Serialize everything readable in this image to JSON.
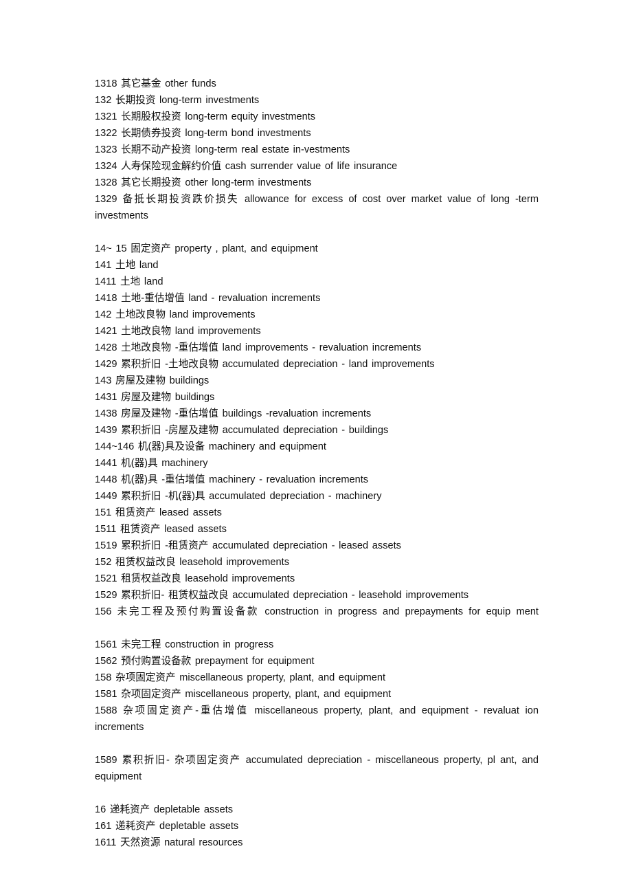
{
  "document": {
    "type": "chart-of-accounts",
    "language": "zh-en-bilingual",
    "background_color": "#ffffff",
    "text_color": "#101010",
    "entries": [
      {
        "code": "1318",
        "zh": "其它基金",
        "en": "other funds",
        "text": "1318 其它基金 other funds",
        "wraps": false
      },
      {
        "code": "132",
        "zh": "长期投资",
        "en": "long-term investments",
        "text": "132 长期投资 long-term investments",
        "wraps": false
      },
      {
        "code": "1321",
        "zh": "长期股权投资",
        "en": "long-term equity investments",
        "text": "1321 长期股权投资 long-term equity investments",
        "wraps": false
      },
      {
        "code": "1322",
        "zh": "长期债券投资",
        "en": "long-term bond investments",
        "text": "1322 长期债券投资 long-term bond investments",
        "wraps": false
      },
      {
        "code": "1323",
        "zh": "长期不动产投资",
        "en": "long-term real estate in-vestments",
        "text": "1323 长期不动产投资 long-term real estate in-vestments",
        "wraps": false
      },
      {
        "code": "1324",
        "zh": "人寿保险现金解约价值",
        "en": "cash surrender value of life insurance",
        "text": "1324 人寿保险现金解约价值 cash surrender value of life insurance",
        "wraps": false
      },
      {
        "code": "1328",
        "zh": "其它长期投资",
        "en": "other long-term investments",
        "text": "1328 其它长期投资 other long-term investments",
        "wraps": false
      },
      {
        "code": "1329",
        "zh": "备抵长期投资跌价损失",
        "en": "allowance for excess of cost over market value of long-term investments",
        "text": "1329 备抵长期投资跌价损失 allowance for excess of cost over market value of long -term investments",
        "wraps": true
      },
      {
        "code": "14~ 15",
        "zh": "固定资产",
        "en": "property , plant, and equipment",
        "text": "14~ 15 固定资产 property , plant, and equipment",
        "wraps": false
      },
      {
        "code": "141",
        "zh": "土地",
        "en": "land",
        "text": "141 土地 land",
        "wraps": false
      },
      {
        "code": "1411",
        "zh": "土地",
        "en": "land",
        "text": "1411 土地 land",
        "wraps": false
      },
      {
        "code": "1418",
        "zh": "土地-重估增值",
        "en": "land - revaluation increments",
        "text": "1418 土地-重估增值 land - revaluation increments",
        "wraps": false
      },
      {
        "code": "142",
        "zh": "土地改良物",
        "en": "land improvements",
        "text": "142 土地改良物 land improvements",
        "wraps": false
      },
      {
        "code": "1421",
        "zh": "土地改良物",
        "en": "land improvements",
        "text": "1421 土地改良物 land improvements",
        "wraps": false
      },
      {
        "code": "1428",
        "zh": "土地改良物 -重估增值",
        "en": "land improvements - revaluation increments",
        "text": "1428 土地改良物 -重估增值 land improvements - revaluation increments",
        "wraps": false
      },
      {
        "code": "1429",
        "zh": "累积折旧 -土地改良物",
        "en": "accumulated depreciation - land improvements",
        "text": "1429 累积折旧 -土地改良物 accumulated depreciation - land improvements",
        "wraps": false
      },
      {
        "code": "143",
        "zh": "房屋及建物",
        "en": "buildings",
        "text": "143 房屋及建物 buildings",
        "wraps": false
      },
      {
        "code": "1431",
        "zh": "房屋及建物",
        "en": "buildings",
        "text": "1431 房屋及建物 buildings",
        "wraps": false
      },
      {
        "code": "1438",
        "zh": "房屋及建物 -重估增值",
        "en": "buildings -revaluation increments",
        "text": "1438 房屋及建物 -重估增值 buildings -revaluation increments",
        "wraps": false
      },
      {
        "code": "1439",
        "zh": "累积折旧 -房屋及建物",
        "en": "accumulated depreciation - buildings",
        "text": "1439 累积折旧 -房屋及建物 accumulated depreciation - buildings",
        "wraps": false
      },
      {
        "code": "144~146",
        "zh": "机(器)具及设备",
        "en": "machinery and equipment",
        "text": "144~146 机(器)具及设备 machinery and equipment",
        "wraps": false
      },
      {
        "code": "1441",
        "zh": "机(器)具",
        "en": "machinery",
        "text": "1441 机(器)具 machinery",
        "wraps": false
      },
      {
        "code": "1448",
        "zh": "机(器)具 -重估增值",
        "en": "machinery - revaluation increments",
        "text": "1448 机(器)具 -重估增值 machinery - revaluation increments",
        "wraps": false
      },
      {
        "code": "1449",
        "zh": "累积折旧 -机(器)具",
        "en": "accumulated depreciation - machinery",
        "text": "1449 累积折旧 -机(器)具 accumulated depreciation - machinery",
        "wraps": false
      },
      {
        "code": "151",
        "zh": "租赁资产",
        "en": "leased assets",
        "text": "151 租赁资产 leased assets",
        "wraps": false
      },
      {
        "code": "1511",
        "zh": "租赁资产",
        "en": "leased assets",
        "text": "1511 租赁资产 leased assets",
        "wraps": false
      },
      {
        "code": "1519",
        "zh": "累积折旧 -租赁资产",
        "en": "accumulated depreciation - leased assets",
        "text": "1519 累积折旧 -租赁资产 accumulated depreciation - leased assets",
        "wraps": false
      },
      {
        "code": "152",
        "zh": "租赁权益改良",
        "en": "leasehold improvements",
        "text": "152 租赁权益改良 leasehold improvements",
        "wraps": false
      },
      {
        "code": "1521",
        "zh": "租赁权益改良",
        "en": "leasehold improvements",
        "text": "1521 租赁权益改良 leasehold improvements",
        "wraps": false
      },
      {
        "code": "1529",
        "zh": "累积折旧- 租赁权益改良",
        "en": "accumulated depreciation - leasehold improvements",
        "text": "1529 累积折旧- 租赁权益改良 accumulated depreciation - leasehold improvements",
        "wraps": false
      },
      {
        "code": "156",
        "zh": "未完工程及预付购置设备款",
        "en": "construction in progress and prepayments for equipment",
        "text": "156 未完工程及预付购置设备款 construction in progress and prepayments for equip ment",
        "wraps": true
      },
      {
        "code": "1561",
        "zh": "未完工程",
        "en": "construction in progress",
        "text": "1561 未完工程 construction in progress",
        "wraps": false
      },
      {
        "code": "1562",
        "zh": "预付购置设备款",
        "en": "prepayment for equipment",
        "text": "1562 预付购置设备款 prepayment for equipment",
        "wraps": false
      },
      {
        "code": "158",
        "zh": "杂项固定资产",
        "en": "miscellaneous property, plant, and equipment",
        "text": "158 杂项固定资产 miscellaneous property, plant, and equipment",
        "wraps": false
      },
      {
        "code": "1581",
        "zh": "杂项固定资产",
        "en": "miscellaneous property, plant, and equipment",
        "text": "1581 杂项固定资产 miscellaneous property, plant, and equipment",
        "wraps": false
      },
      {
        "code": "1588",
        "zh": "杂项固定资产-重估增值",
        "en": "miscellaneous property, plant, and equipment - revaluation increments",
        "text": "1588 杂项固定资产-重估增值 miscellaneous property, plant, and equipment - revaluat ion increments",
        "wraps": true
      },
      {
        "code": "1589",
        "zh": "累积折旧- 杂项固定资产",
        "en": "accumulated depreciation - miscellaneous property, plant, and equipment",
        "text": "1589 累积折旧- 杂项固定资产 accumulated depreciation - miscellaneous property, pl ant, and equipment",
        "wraps": true
      },
      {
        "code": "16",
        "zh": "递耗资产",
        "en": "depletable assets",
        "text": "16 递耗资产 depletable assets",
        "wraps": false
      },
      {
        "code": "161",
        "zh": "递耗资产",
        "en": "depletable assets",
        "text": "161 递耗资产 depletable assets",
        "wraps": false
      },
      {
        "code": "1611",
        "zh": "天然资源",
        "en": "natural resources",
        "text": "1611 天然资源 natural resources",
        "wraps": false
      }
    ]
  }
}
